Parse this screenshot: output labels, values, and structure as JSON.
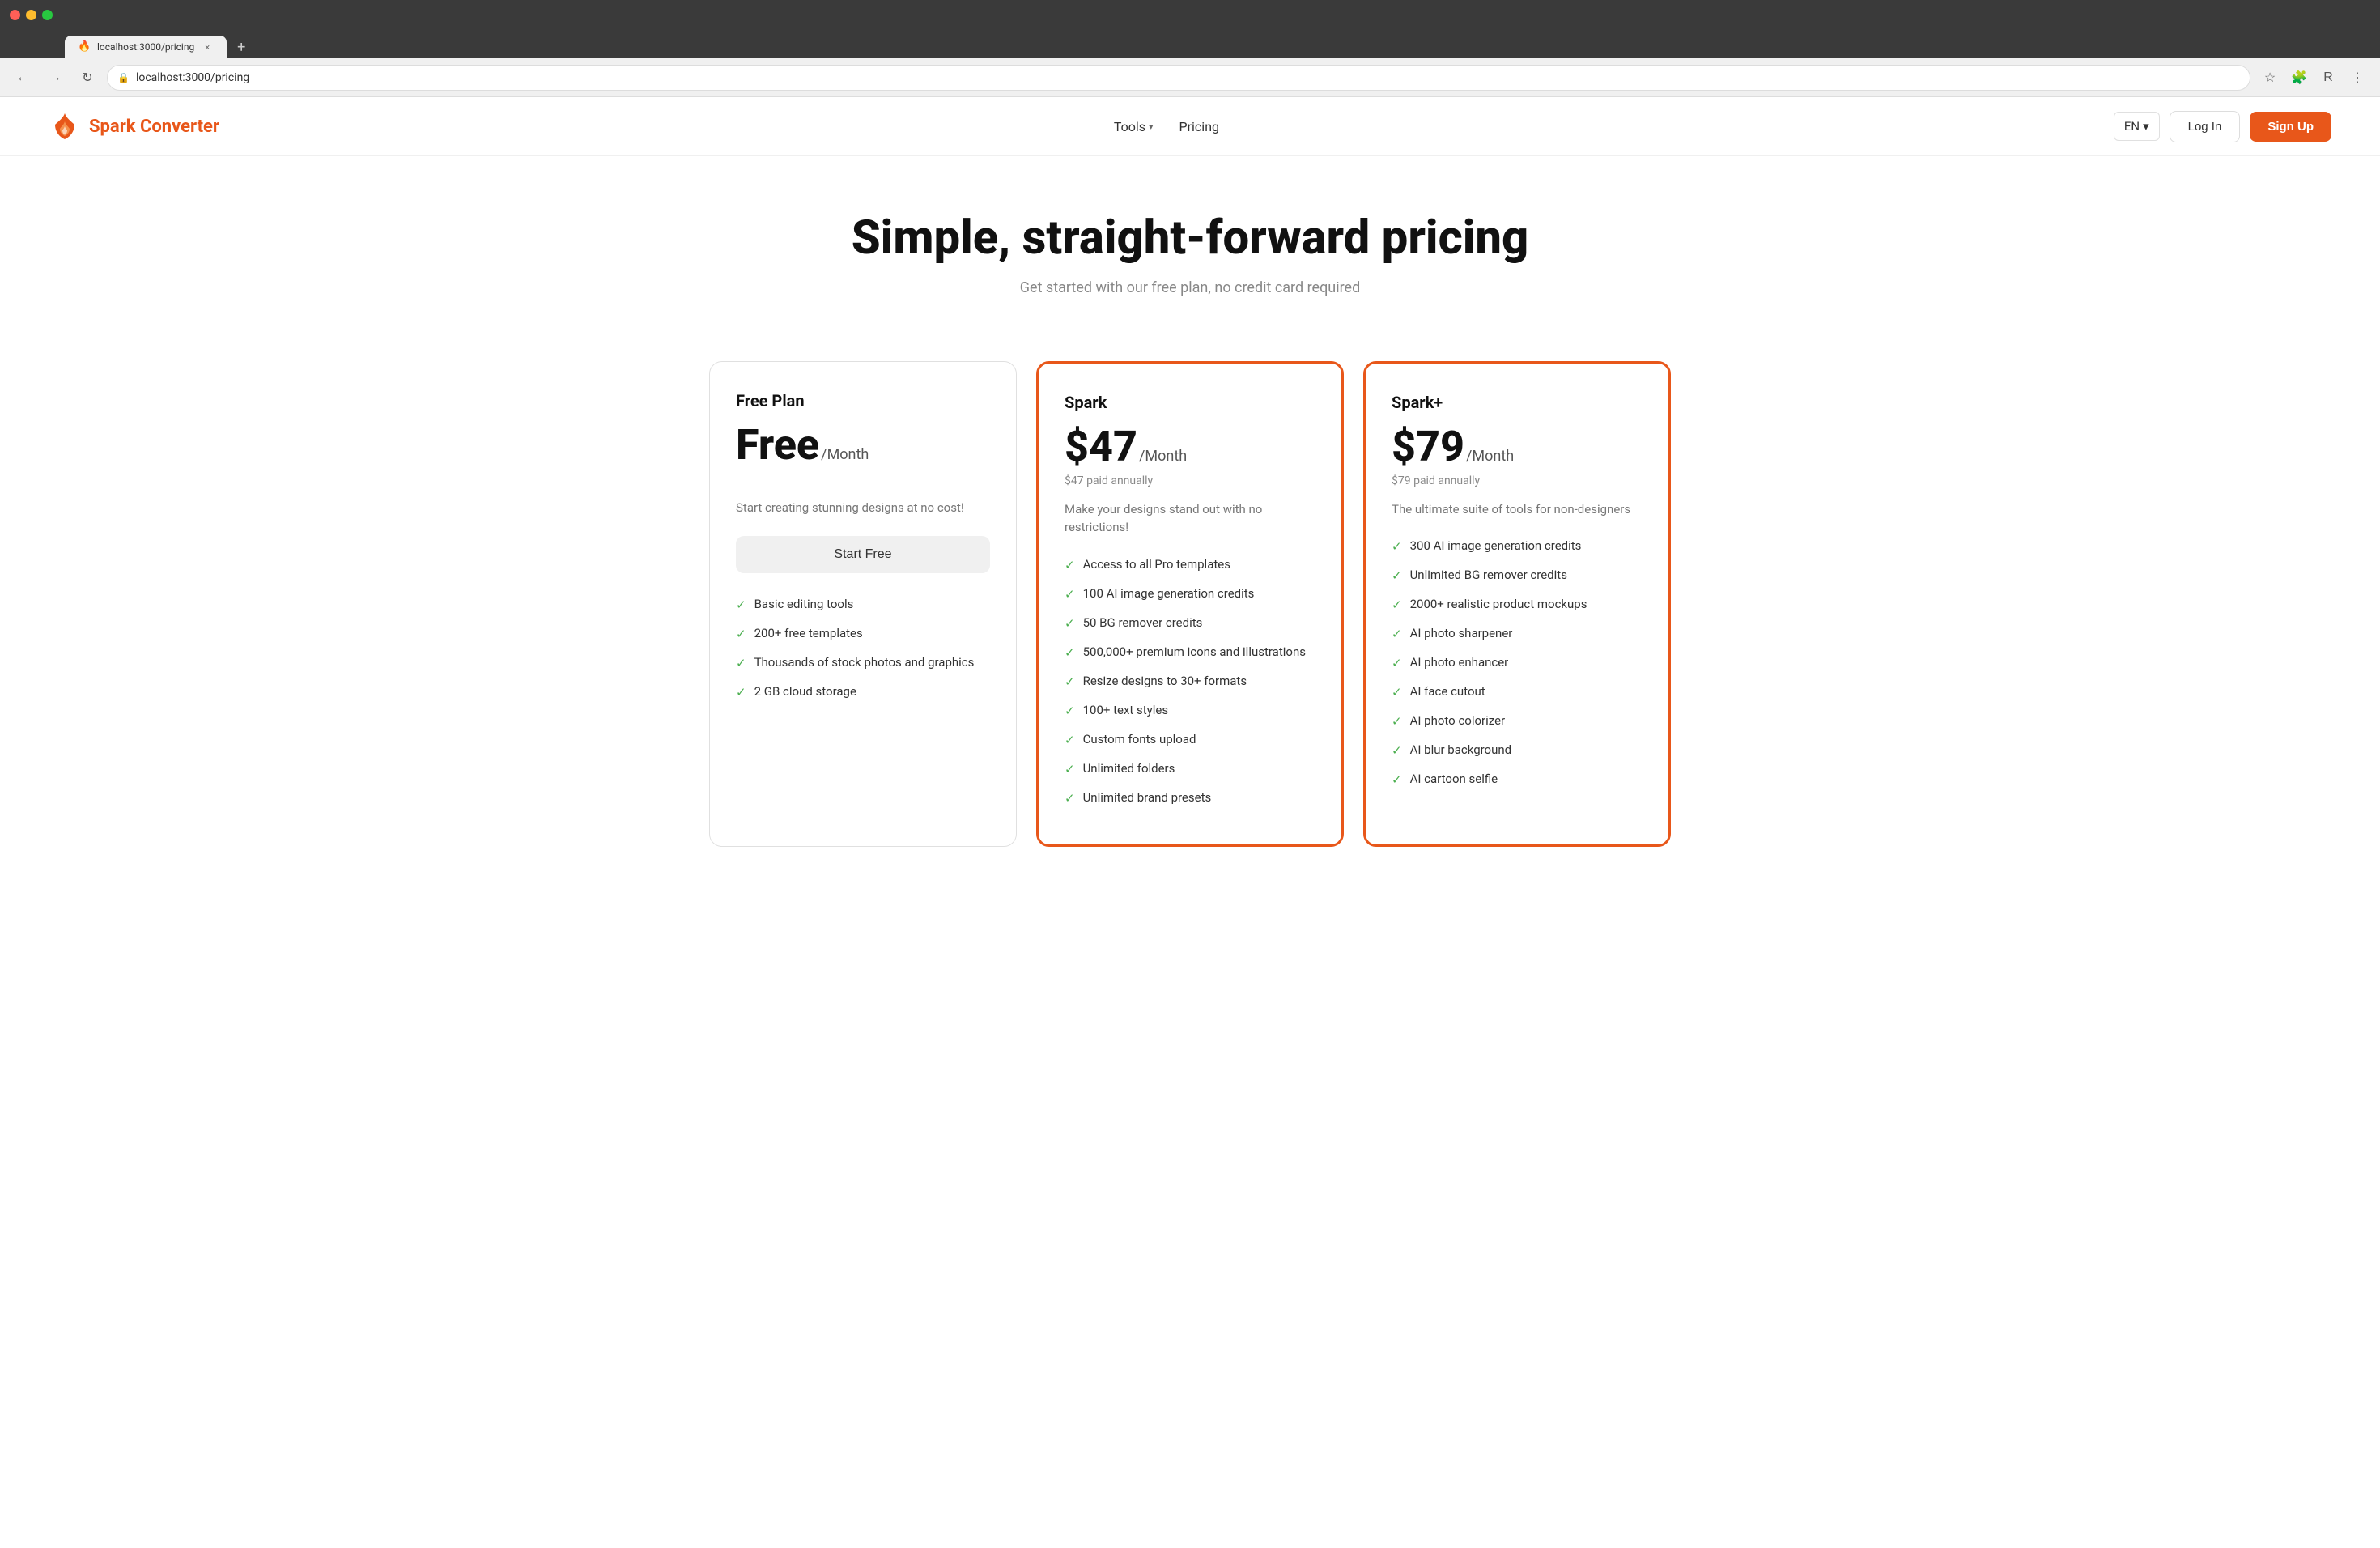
{
  "browser": {
    "tab_favicon": "🔥",
    "tab_title": "localhost:3000/pricing",
    "tab_close": "×",
    "new_tab": "+",
    "back": "←",
    "forward": "→",
    "refresh": "↻",
    "address": "localhost:3000/pricing",
    "bookmark_icon": "☆",
    "extensions_icon": "🧩",
    "profile_icon": "R",
    "menu_icon": "⋮"
  },
  "nav": {
    "logo_text": "Spark Converter",
    "tools_label": "Tools",
    "pricing_label": "Pricing",
    "lang_label": "EN",
    "login_label": "Log In",
    "signup_label": "Sign Up"
  },
  "hero": {
    "title": "Simple, straight-forward pricing",
    "subtitle": "Get started with our free plan, no credit card required"
  },
  "plans": [
    {
      "id": "free",
      "name": "Free Plan",
      "price": "Free",
      "period": "/Month",
      "annual_note": "",
      "description": "Start creating stunning designs at no cost!",
      "cta": "Start Free",
      "features": [
        "Basic editing tools",
        "200+ free templates",
        "Thousands of stock photos and graphics",
        "2 GB cloud storage"
      ]
    },
    {
      "id": "spark",
      "name": "Spark",
      "price": "$47",
      "period": "/Month",
      "annual_note": "$47 paid annually",
      "description": "Make your designs stand out with no restrictions!",
      "cta": "",
      "features": [
        "Access to all Pro templates",
        "100 AI image generation credits",
        "50 BG remover credits",
        "500,000+ premium icons and illustrations",
        "Resize designs to 30+ formats",
        "100+ text styles",
        "Custom fonts upload",
        "Unlimited folders",
        "Unlimited brand presets"
      ]
    },
    {
      "id": "spark-plus",
      "name": "Spark+",
      "price": "$79",
      "period": "/Month",
      "annual_note": "$79 paid annually",
      "description": "The ultimate suite of tools for non-designers",
      "cta": "",
      "features": [
        "300 AI image generation credits",
        "Unlimited BG remover credits",
        "2000+ realistic product mockups",
        "AI photo sharpener",
        "AI photo enhancer",
        "AI face cutout",
        "AI photo colorizer",
        "AI blur background",
        "AI cartoon selfie"
      ]
    }
  ],
  "colors": {
    "accent": "#e8571a",
    "check": "#4caf50",
    "border_default": "#e0e0e0"
  }
}
